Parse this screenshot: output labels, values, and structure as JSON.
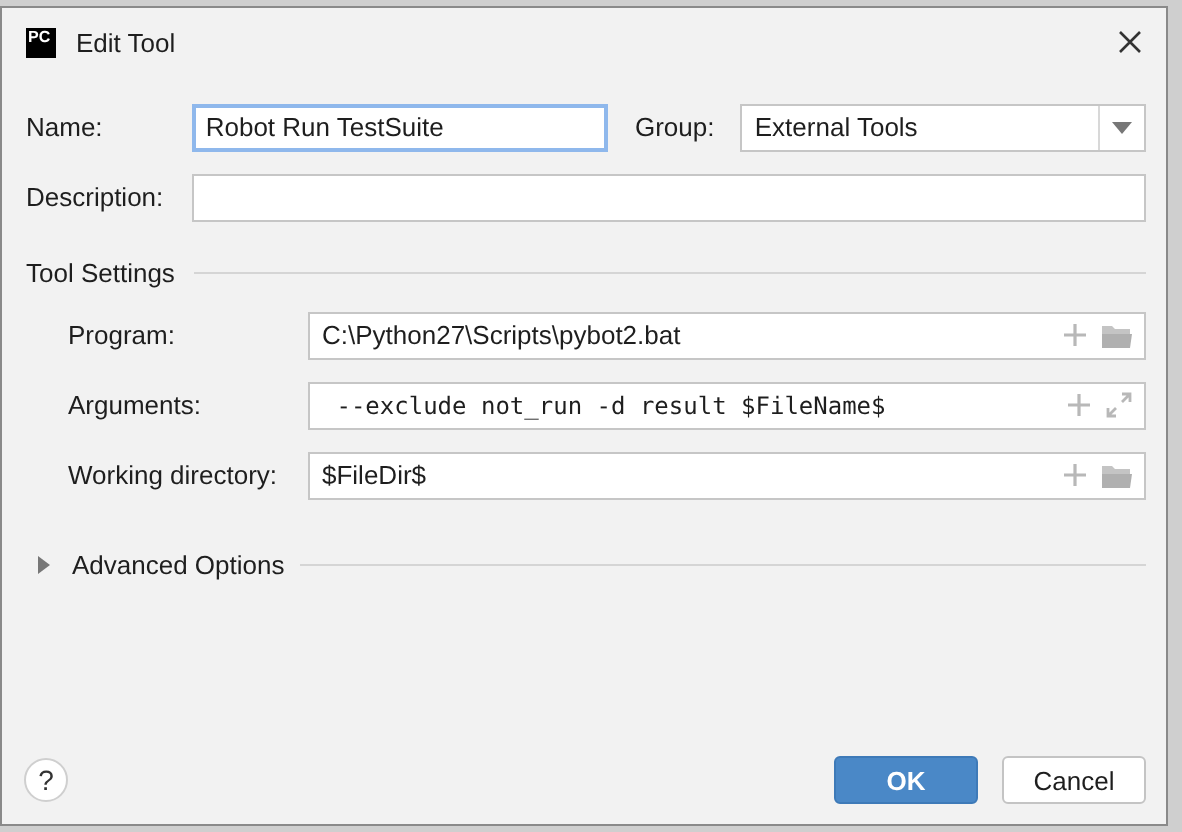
{
  "window": {
    "title": "Edit Tool",
    "logo": "PC"
  },
  "name": {
    "label": "Name:",
    "value": "Robot Run TestSuite",
    "focused": true
  },
  "group": {
    "label": "Group:",
    "value": "External Tools"
  },
  "description": {
    "label": "Description:"
  },
  "tool_settings": {
    "title": "Tool Settings",
    "fields": [
      {
        "label": "Program:",
        "value": "C:\\Python27\\Scripts\\pybot2.bat",
        "kind": "browse"
      },
      {
        "label": "Arguments:",
        "value": " --exclude not_run -d result $FileName$",
        "kind": "expand"
      },
      {
        "label": "Working directory:",
        "value": "$FileDir$",
        "kind": "browse"
      }
    ]
  },
  "advanced": {
    "title": "Advanced Options",
    "expanded": false
  },
  "help": "?",
  "buttons": [
    {
      "label": "OK",
      "default": true
    },
    {
      "label": "Cancel",
      "default": false
    }
  ]
}
